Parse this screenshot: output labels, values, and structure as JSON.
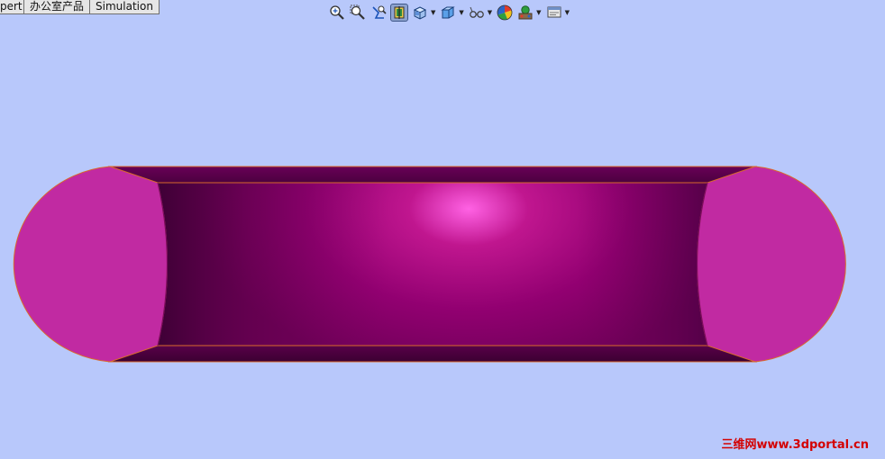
{
  "tabs": [
    "pert",
    "办公室产品",
    "Simulation"
  ],
  "toolbar": {
    "buttons": [
      {
        "name": "zoom-to-fit-icon",
        "dropdown": false,
        "active": false
      },
      {
        "name": "zoom-to-area-icon",
        "dropdown": false,
        "active": false
      },
      {
        "name": "previous-view-icon",
        "dropdown": false,
        "active": false
      },
      {
        "name": "section-view-icon",
        "dropdown": false,
        "active": true
      },
      {
        "name": "view-orientation-icon",
        "dropdown": true,
        "active": false
      },
      {
        "name": "display-style-icon",
        "dropdown": true,
        "active": false
      },
      {
        "name": "hide-show-items-icon",
        "dropdown": true,
        "active": false
      },
      {
        "name": "edit-appearance-icon",
        "dropdown": false,
        "active": false
      },
      {
        "name": "apply-scene-icon",
        "dropdown": true,
        "active": false
      },
      {
        "name": "view-settings-icon",
        "dropdown": true,
        "active": false
      }
    ]
  },
  "model": {
    "cap_color": "#c12aa2",
    "inner_highlight": "#ff62e4",
    "inner_dark": "#3e0036",
    "edge_color": "#d86a2c"
  },
  "watermark": "三维网www.3dportal.cn",
  "colors": {
    "background": "#b8c8fb"
  }
}
